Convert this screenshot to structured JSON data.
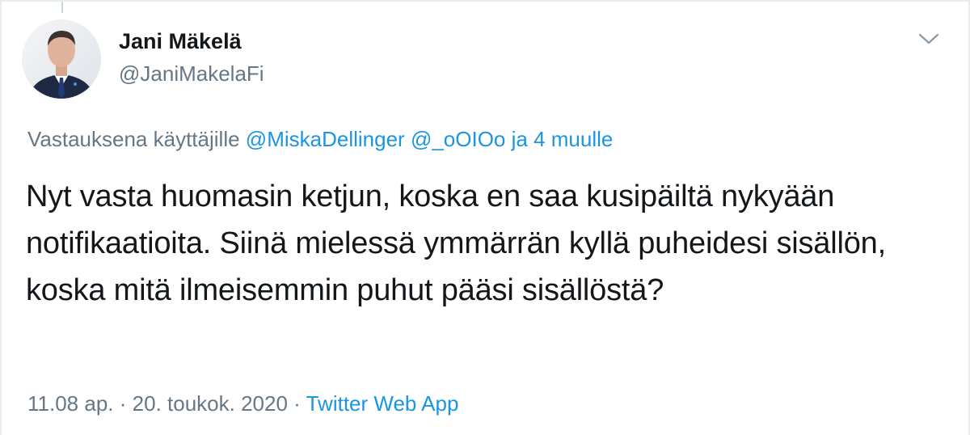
{
  "tweet": {
    "author": {
      "display_name": "Jani Mäkelä",
      "handle": "@JaniMakelaFi"
    },
    "reply_context": {
      "prefix": "Vastauksena käyttäjille",
      "mention_1": "@MiskaDellinger",
      "mention_2": "@_oOIOo",
      "suffix": "ja 4 muulle"
    },
    "text": "Nyt vasta huomasin ketjun, koska en saa kusipäiltä nykyään notifikaatioita. Siinä mielessä ymmärrän kyllä puheidesi sisällön, koska mitä ilmeisemmin puhut pääsi sisällöstä?",
    "time": "11.08 ap.",
    "separator": "·",
    "date": "20. toukok. 2020",
    "source": "Twitter Web App"
  },
  "icons": {
    "menu": "chevron-down-icon",
    "avatar": "profile-photo"
  },
  "colors": {
    "text": "#14171a",
    "secondary": "#657786",
    "link": "#1b95e0",
    "border": "#e6ecf0"
  }
}
